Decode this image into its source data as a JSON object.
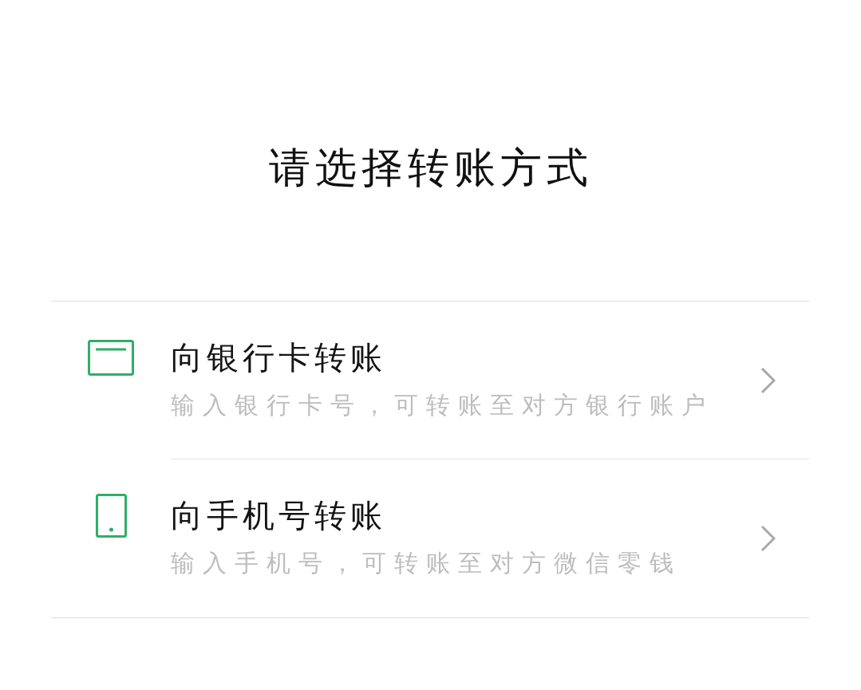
{
  "header": {
    "title": "请选择转账方式"
  },
  "options": [
    {
      "kind": "bank_card",
      "title": "向银行卡转账",
      "description": "输入银行卡号，可转账至对方银行账户"
    },
    {
      "kind": "phone",
      "title": "向手机号转账",
      "description": "输入手机号，可转账至对方微信零钱"
    }
  ]
}
